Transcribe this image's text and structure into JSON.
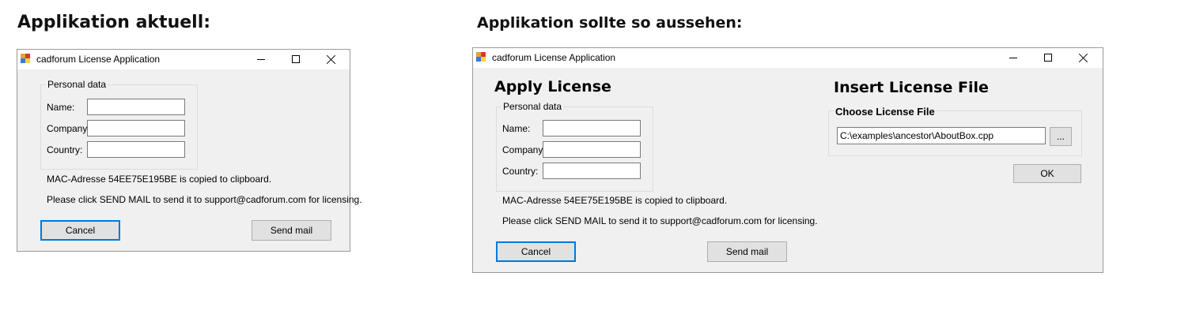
{
  "headings": {
    "current": "Applikation aktuell:",
    "target": "Applikation sollte so aussehen:"
  },
  "window": {
    "title": "cadforum License Application"
  },
  "personal_data": {
    "legend": "Personal data",
    "name_label": "Name:",
    "company_label": "Company:",
    "country_label": "Country:",
    "name_value": "",
    "company_value": "",
    "country_value": ""
  },
  "messages": {
    "mac": "MAC-Adresse 54EE75E195BE is copied to clipboard.",
    "instruction": "Please click SEND MAIL to send it to support@cadforum.com for licensing."
  },
  "buttons": {
    "cancel": "Cancel",
    "send_mail": "Send mail",
    "ok": "OK",
    "browse": "..."
  },
  "apply_license": {
    "title": "Apply License"
  },
  "insert_license": {
    "title": "Insert License File",
    "group_legend": "Choose License File",
    "file_path": "C:\\examples\\ancestor\\AboutBox.cpp"
  }
}
